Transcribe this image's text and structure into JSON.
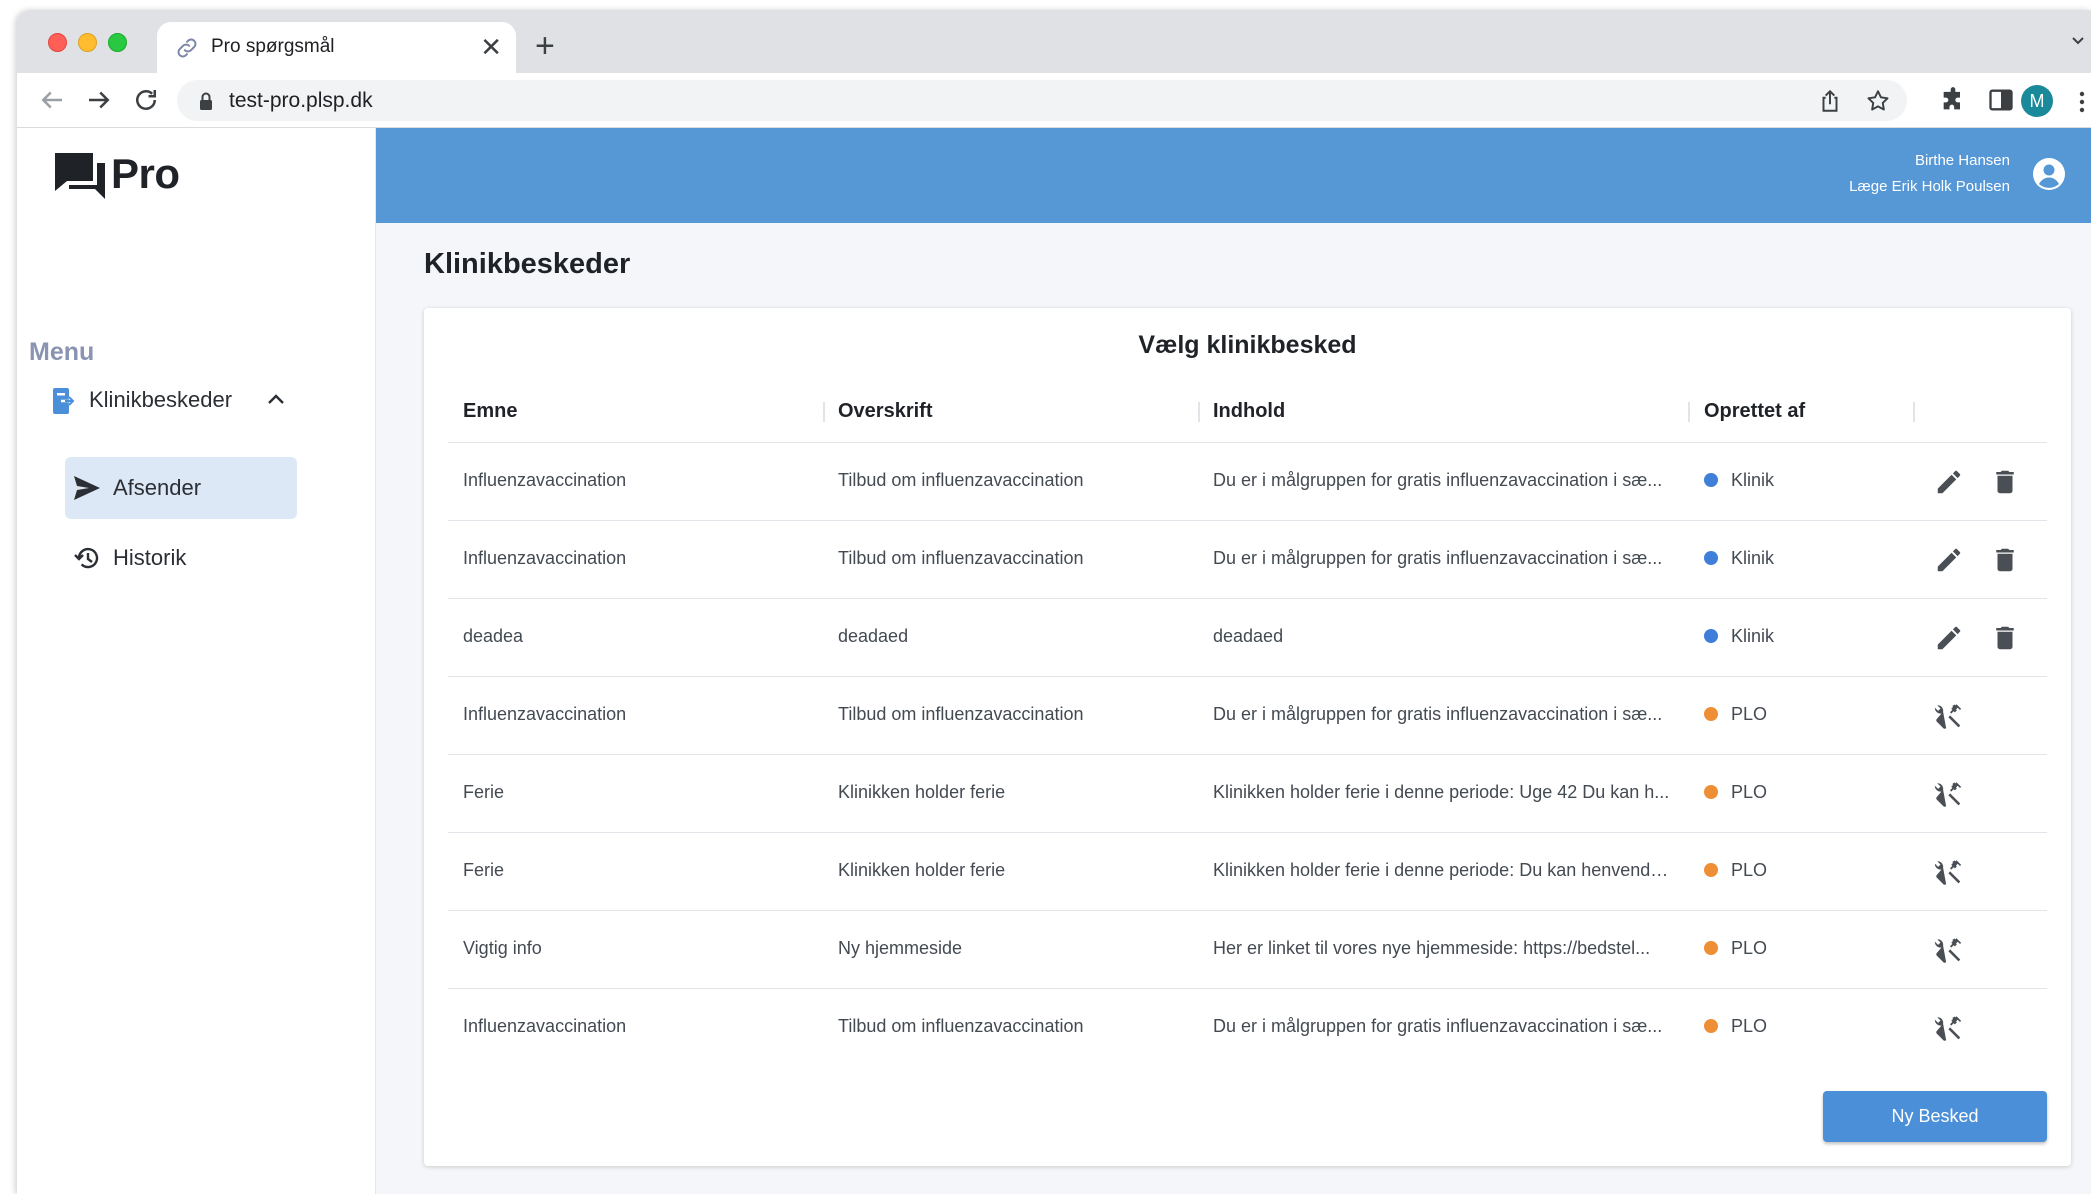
{
  "browser": {
    "tab_title": "Pro spørgsmål",
    "tab_close": "✕",
    "new_tab": "+",
    "url": "test-pro.plsp.dk",
    "profile_initial": "M"
  },
  "app": {
    "logo_text": "Pro",
    "user": {
      "name": "Birthe Hansen",
      "role": "Læge Erik Holk Poulsen"
    }
  },
  "sidebar": {
    "menu_heading": "Menu",
    "group_label": "Klinikbeskeder",
    "items": [
      {
        "label": "Afsender",
        "icon": "send-icon",
        "active": true
      },
      {
        "label": "Historik",
        "icon": "history-icon",
        "active": false
      }
    ]
  },
  "main": {
    "page_title": "Klinikbeskeder",
    "card_title": "Vælg klinikbesked",
    "columns": [
      "Emne",
      "Overskrift",
      "Indhold",
      "Oprettet af"
    ],
    "rows": [
      {
        "emne": "Influenzavaccination",
        "overskrift": "Tilbud om influenzavaccination",
        "indhold": "Du er i målgruppen for gratis influenzavaccination i sæ...",
        "oprettet_af": "Klinik",
        "type": "klinik"
      },
      {
        "emne": "Influenzavaccination",
        "overskrift": "Tilbud om influenzavaccination",
        "indhold": "Du er i målgruppen for gratis influenzavaccination i sæ...",
        "oprettet_af": "Klinik",
        "type": "klinik"
      },
      {
        "emne": "deadea",
        "overskrift": "deadaed",
        "indhold": "deadaed",
        "oprettet_af": "Klinik",
        "type": "klinik"
      },
      {
        "emne": "Influenzavaccination",
        "overskrift": "Tilbud om influenzavaccination",
        "indhold": "Du er i målgruppen for gratis influenzavaccination i sæ...",
        "oprettet_af": "PLO",
        "type": "plo"
      },
      {
        "emne": "Ferie",
        "overskrift": "Klinikken holder ferie",
        "indhold": "Klinikken holder ferie i denne periode: Uge 42 Du kan h...",
        "oprettet_af": "PLO",
        "type": "plo"
      },
      {
        "emne": "Ferie",
        "overskrift": "Klinikken holder ferie",
        "indhold": "Klinikken holder ferie i denne periode: Du kan henvende...",
        "oprettet_af": "PLO",
        "type": "plo"
      },
      {
        "emne": "Vigtig info",
        "overskrift": "Ny hjemmeside",
        "indhold": "Her er linket til vores nye hjemmeside: https://bedstel...",
        "oprettet_af": "PLO",
        "type": "plo"
      },
      {
        "emne": "Influenzavaccination",
        "overskrift": "Tilbud om influenzavaccination",
        "indhold": "Du er i målgruppen for gratis influenzavaccination i sæ...",
        "oprettet_af": "PLO",
        "type": "plo"
      }
    ],
    "new_button_label": "Ny Besked"
  },
  "colors": {
    "header_blue": "#5697d6",
    "klinik_dot": "#3f7fd9",
    "plo_dot": "#ef8f35",
    "button_blue": "#4a8fd8"
  }
}
